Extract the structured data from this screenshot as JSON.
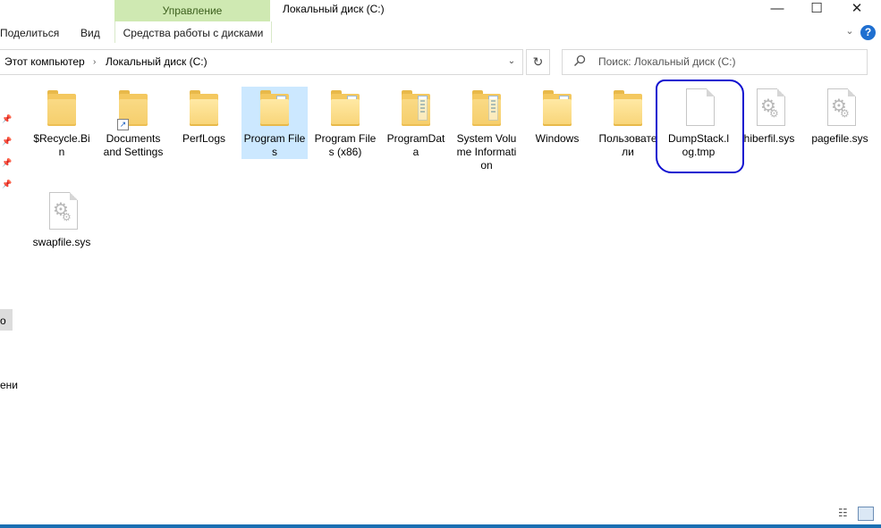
{
  "ribbon": {
    "manage_tab": "Управление",
    "manage_subtab": "Средства работы с дисками",
    "share_tab": "Поделиться",
    "view_tab": "Вид"
  },
  "window": {
    "title": "Локальный диск (C:)",
    "minimize": "—",
    "maximize": "☐",
    "close": "✕"
  },
  "address": {
    "crumbs": [
      "Этот компьютер",
      "Локальный диск (C:)"
    ],
    "separator": "›",
    "dropdown": "⌄",
    "refresh": "↻"
  },
  "search": {
    "placeholder": "Поиск: Локальный диск (C:)"
  },
  "nav": {
    "fragment_1": "о",
    "fragment_2": "ени"
  },
  "items": [
    {
      "label": "$Recycle.Bin",
      "icon": "folder-icon"
    },
    {
      "label": "Documents and Settings",
      "icon": "shortcut-folder-icon"
    },
    {
      "label": "PerfLogs",
      "icon": "folder-icon"
    },
    {
      "label": "Program Files",
      "icon": "folder-icon",
      "selected": true
    },
    {
      "label": "Program Files (x86)",
      "icon": "folder-icon"
    },
    {
      "label": "ProgramData",
      "icon": "folder-icon"
    },
    {
      "label": "System Volume Information",
      "icon": "folder-icon"
    },
    {
      "label": "Windows",
      "icon": "folder-icon"
    },
    {
      "label": "Пользователи",
      "icon": "folder-icon"
    },
    {
      "label": "DumpStack.log.tmp",
      "icon": "file-icon",
      "circled": true
    },
    {
      "label": "hiberfil.sys",
      "icon": "system-file-icon"
    },
    {
      "label": "pagefile.sys",
      "icon": "system-file-icon"
    },
    {
      "label": "swapfile.sys",
      "icon": "system-file-icon"
    }
  ],
  "colors": {
    "manage_tab_bg": "#cfe9b2",
    "selection_bg": "#cce8ff",
    "annotation": "#1010d0",
    "help": "#1f6fd0"
  }
}
